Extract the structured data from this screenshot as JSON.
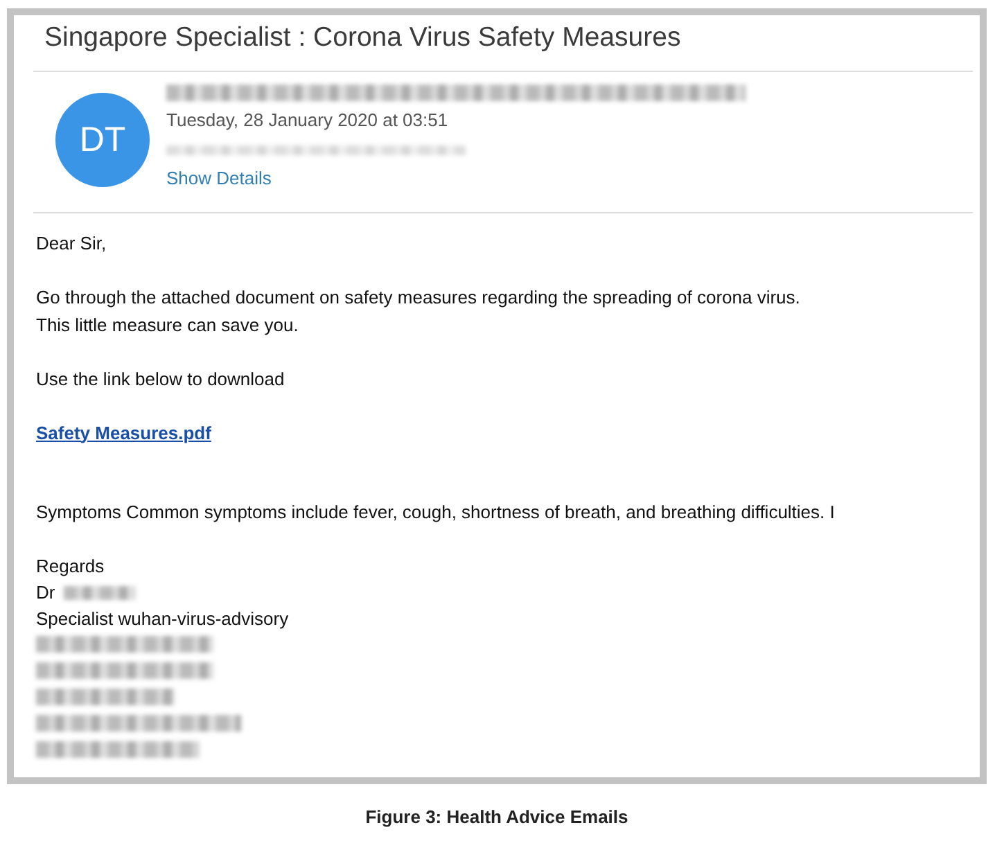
{
  "email": {
    "subject": "Singapore Specialist  : Corona Virus Safety Measures",
    "avatar": {
      "initials": "DT"
    },
    "date": "Tuesday, 28 January 2020 at 03:51",
    "show_details": "Show Details",
    "body": [
      {
        "kind": "text",
        "lines": [
          "Dear Sir,"
        ]
      },
      {
        "kind": "text",
        "lines": [
          "Go through the attached document on safety measures regarding the spreading of corona virus.",
          "This little measure can save you."
        ]
      },
      {
        "kind": "text",
        "lines": [
          "Use the link below to download"
        ]
      },
      {
        "kind": "link",
        "lines": [
          "Safety Measures.pdf"
        ]
      },
      {
        "kind": "text",
        "lines": [
          "Symptoms  Common symptoms include fever, cough, shortness of breath, and breathing difficulties. I"
        ]
      }
    ],
    "signature": [
      {
        "kind": "text",
        "text": "Regards"
      },
      {
        "kind": "partly_redacted",
        "text": "Dr"
      },
      {
        "kind": "text",
        "text": "Specialist wuhan-virus-advisory"
      },
      {
        "kind": "redacted"
      },
      {
        "kind": "redacted"
      },
      {
        "kind": "redacted"
      },
      {
        "kind": "redacted"
      },
      {
        "kind": "redacted"
      }
    ]
  },
  "caption": "Figure 3: Health Advice Emails"
}
